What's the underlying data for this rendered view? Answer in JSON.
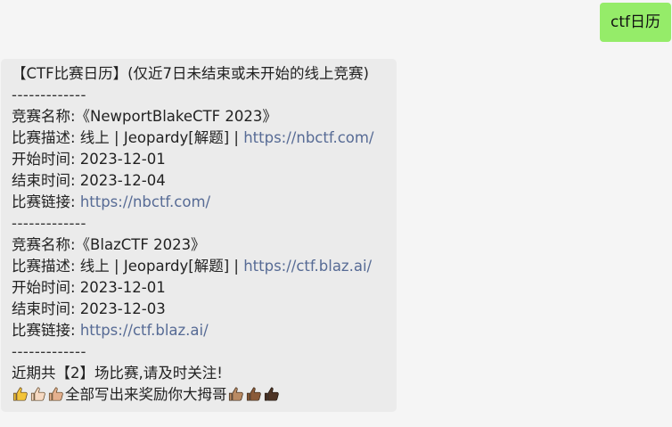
{
  "outgoing": {
    "text": "ctf日历"
  },
  "message": {
    "header": "【CTF比赛日历】(仅近7日未结束或未开始的线上竞赛)",
    "separator": "-------------",
    "events": [
      {
        "name": "竞赛名称:《NewportBlakeCTF 2023》",
        "desc_prefix": "比赛描述: 线上 | Jeopardy[解题] | ",
        "desc_link": "https://nbctf.com/",
        "start": "开始时间: 2023-12-01",
        "end": "结束时间: 2023-12-04",
        "link_prefix": "比赛链接: ",
        "link": "https://nbctf.com/"
      },
      {
        "name": "竞赛名称:《BlazCTF 2023》",
        "desc_prefix": "比赛描述: 线上 | Jeopardy[解题] | ",
        "desc_link": "https://ctf.blaz.ai/",
        "start": "开始时间: 2023-12-01",
        "end": "结束时间: 2023-12-03",
        "link_prefix": "比赛链接: ",
        "link": "https://ctf.blaz.ai/"
      }
    ],
    "footer": "近期共【2】场比赛,请及时关注!",
    "closing": "全部写出来奖励你大拇哥",
    "colors": {
      "thumbs_left": [
        "#f3c43a",
        "#f6d9c2",
        "#e4b08e"
      ],
      "thumbs_right": [
        "#b98a63",
        "#8a5a38",
        "#4e3425"
      ]
    }
  }
}
